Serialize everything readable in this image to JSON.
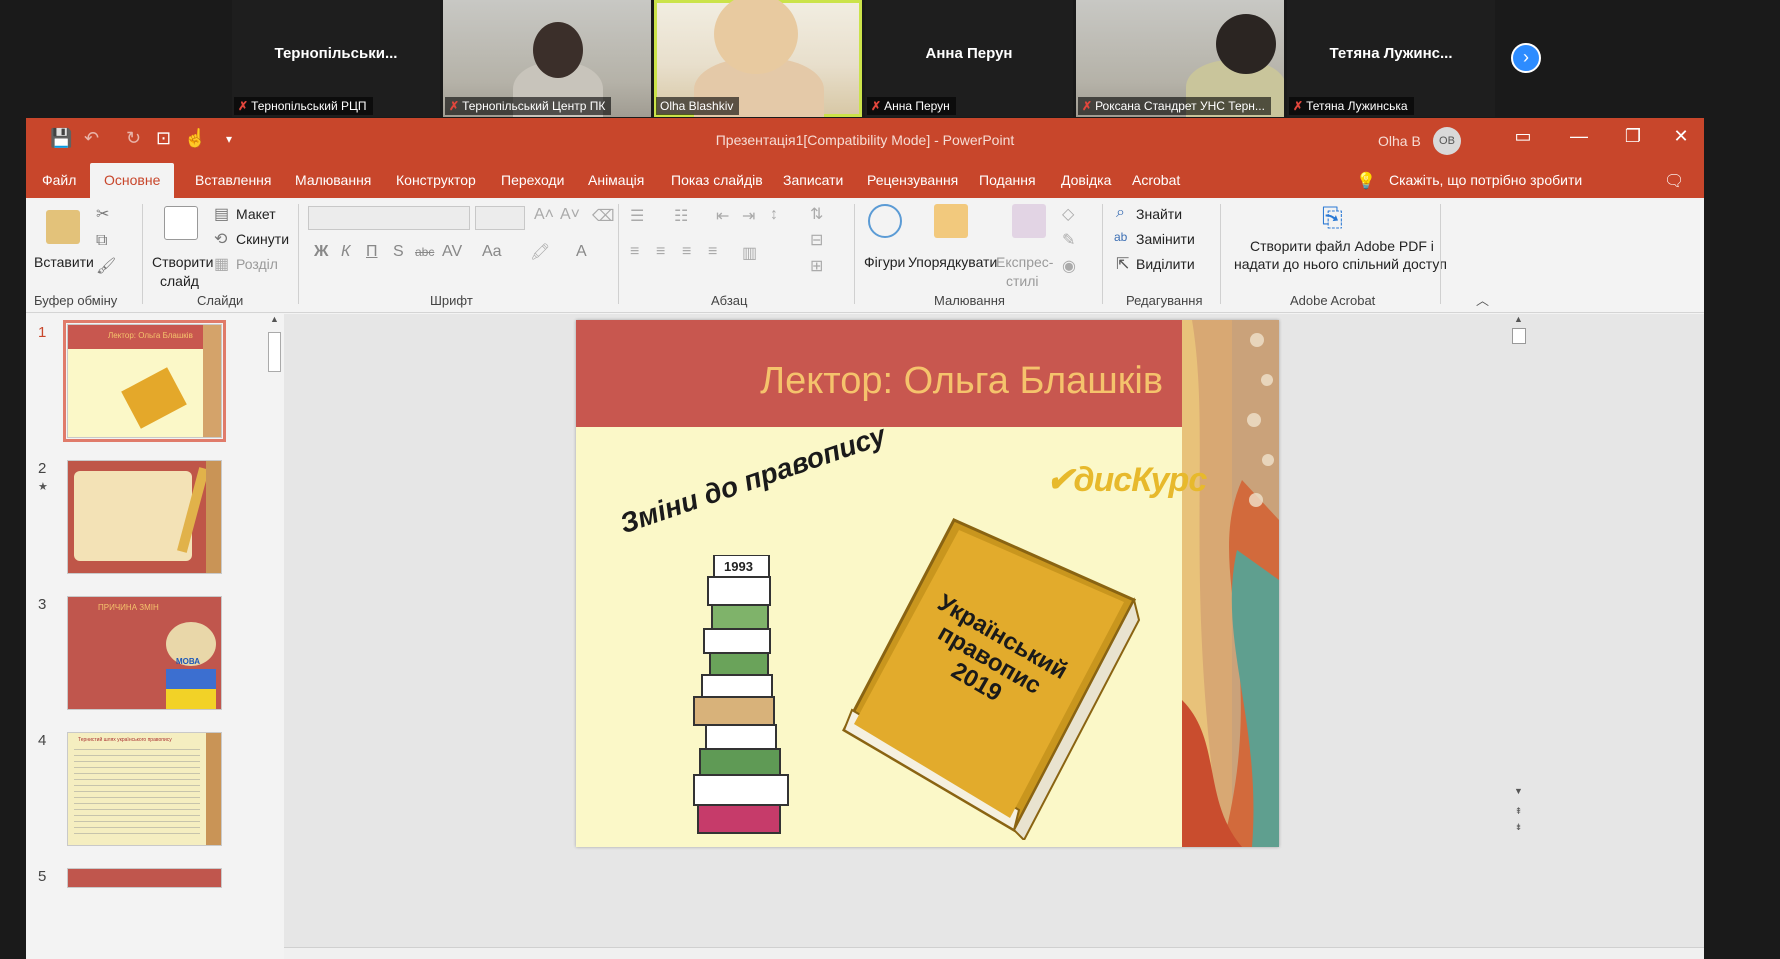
{
  "zoom": {
    "tiles": [
      {
        "center_name": "Тернопільськи...",
        "label": "Тернопільський РЦП",
        "type": "name"
      },
      {
        "center_name": "",
        "label": "Тернопільський Центр ПК",
        "type": "video"
      },
      {
        "center_name": "",
        "label": "Olha Blashkiv",
        "type": "video-active"
      },
      {
        "center_name": "Анна Перун",
        "label": "Анна Перун",
        "type": "name"
      },
      {
        "center_name": "",
        "label": "Роксана Стандрет УНС Терн...",
        "type": "video"
      },
      {
        "center_name": "Тетяна  Лужинс...",
        "label": "Тетяна Лужинська",
        "type": "name"
      }
    ],
    "next_icon": "chevron-right-icon"
  },
  "ppt": {
    "title": "Презентація1[Compatibility Mode]  -  PowerPoint",
    "user_name": "Olha B",
    "user_initials": "OB",
    "accent_color": "#c8462b",
    "tabs": [
      "Файл",
      "Основне",
      "Вставлення",
      "Малювання",
      "Конструктор",
      "Переходи",
      "Анімація",
      "Показ слайдів",
      "Записати",
      "Рецензування",
      "Подання",
      "Довідка",
      "Acrobat"
    ],
    "active_tab": "Основне",
    "tell_me": "Скажіть, що потрібно зробити",
    "ribbon": {
      "paste": "Вставити",
      "new_slide": [
        "Створити",
        "слайд"
      ],
      "layout": "Макет",
      "reset": "Скинути",
      "sections": "Розділ",
      "shapes": "Фігури",
      "arrange": "Упорядкувати",
      "quick_styles": [
        "Експрес-",
        "стилі"
      ],
      "find": "Знайти",
      "replace": "Замінити",
      "select": "Виділити",
      "adobe": [
        "Створити файл Adobe PDF і",
        "надати до нього спільний доступ"
      ],
      "font_buttons": [
        "Ж",
        "К",
        "П",
        "S",
        "abc",
        "AV",
        "Aa",
        "A"
      ],
      "groups": [
        "Буфер обміну",
        "Слайди",
        "Шрифт",
        "Абзац",
        "Малювання",
        "Редагування",
        "Adobe Acrobat"
      ]
    },
    "thumbnails": [
      {
        "num": "1",
        "title": "Лектор: Ольга Блашків",
        "selected": true
      },
      {
        "num": "2",
        "title": "",
        "selected": false,
        "star": "★"
      },
      {
        "num": "3",
        "title": "ПРИЧИНА ЗМІН",
        "badge": "МОВА",
        "selected": false
      },
      {
        "num": "4",
        "title": "Тернистий шлях українського правопису",
        "selected": false
      },
      {
        "num": "5",
        "title": "",
        "selected": false
      }
    ],
    "slide": {
      "title": "Лектор: Ольга Блашків",
      "logo": "дисКурс",
      "handwritten": "Зміни до правопису",
      "book_year": "1993",
      "book_title": [
        "Український",
        "правопис",
        "2019"
      ]
    }
  }
}
